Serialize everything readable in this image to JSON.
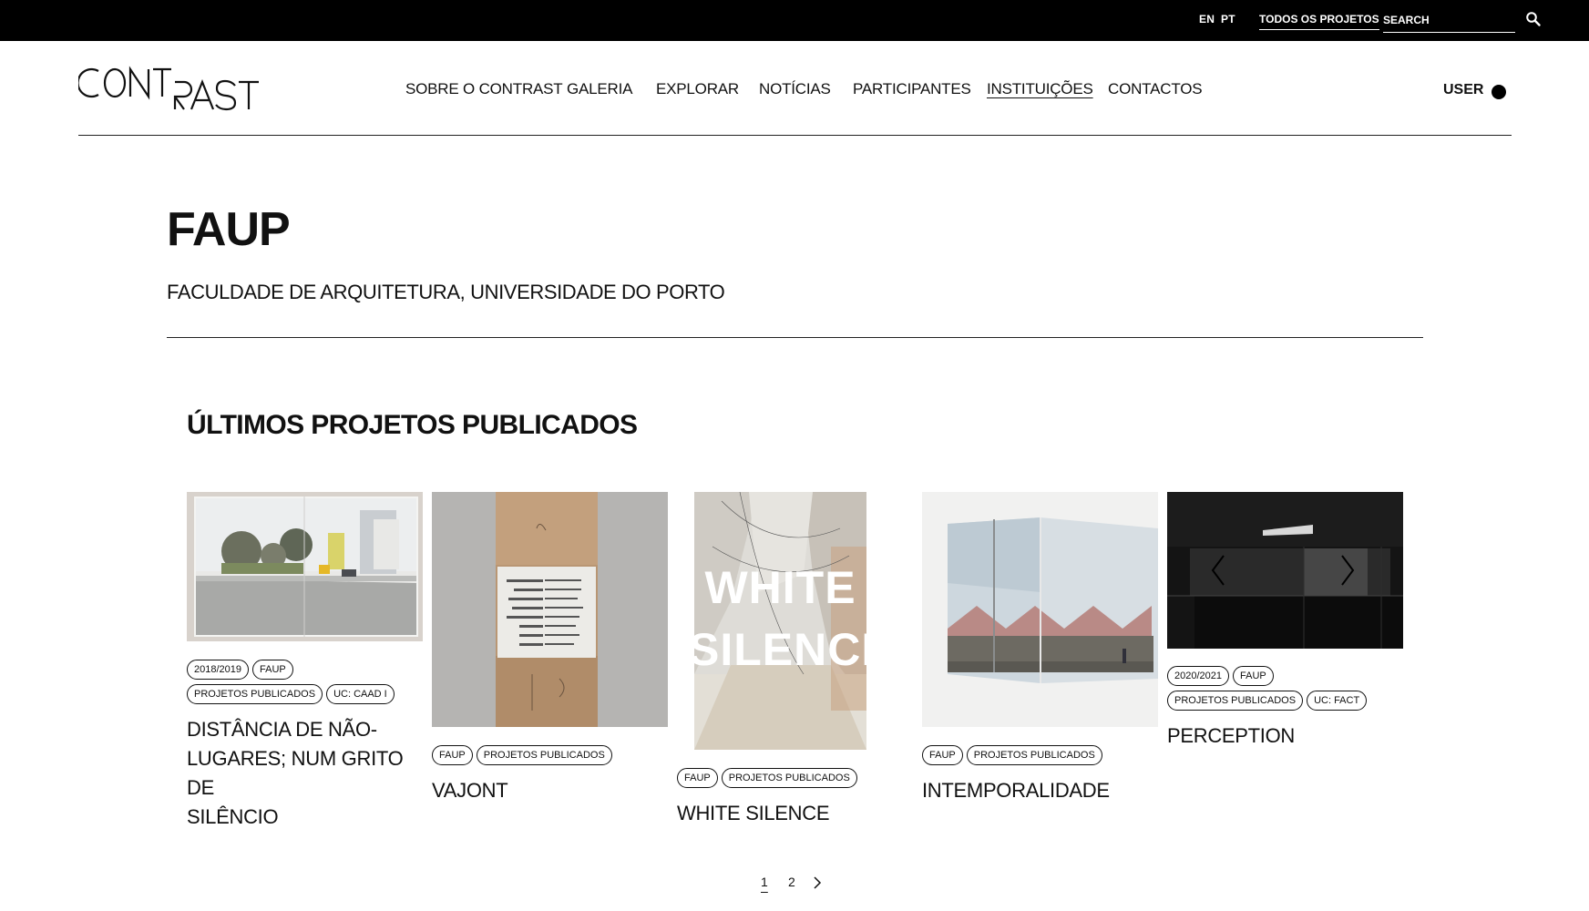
{
  "topbar": {
    "lang_en": "EN",
    "lang_pt": "PT",
    "all_projects": "TODOS OS PROJETOS",
    "search_placeholder": "SEARCH",
    "search_icon": "search-icon"
  },
  "header": {
    "logo_text": "CONTRAST",
    "nav": [
      {
        "label": "SOBRE O CONTRAST"
      },
      {
        "label": "GALERIA"
      },
      {
        "label": "EXPLORAR"
      },
      {
        "label": "NOTÍCIAS"
      },
      {
        "label": "PARTICIPANTES"
      },
      {
        "label": "INSTITUIÇÕES",
        "active": true
      },
      {
        "label": "CONTACTOS"
      }
    ],
    "user_label": "USER"
  },
  "institution": {
    "title": "FAUP",
    "subtitle": "FACULDADE DE ARQUITETURA, UNIVERSIDADE DO PORTO"
  },
  "section": {
    "title": "ÚLTIMOS PROJETOS PUBLICADOS"
  },
  "projects": [
    {
      "tags": [
        "2018/2019",
        "FAUP",
        "PROJETOS PUBLICADOS",
        "UC: CAAD I"
      ],
      "title_lines": [
        "DISTÂNCIA DE NÃO-",
        "LUGARES; NUM GRITO DE",
        "SILÊNCIO"
      ]
    },
    {
      "tags": [
        "FAUP",
        "PROJETOS PUBLICADOS"
      ],
      "title_lines": [
        "VAJONT"
      ]
    },
    {
      "tags": [
        "FAUP",
        "PROJETOS PUBLICADOS"
      ],
      "title_lines": [
        "WHITE SILENCE"
      ],
      "overlay_lines": [
        "WHITE",
        "SILENCE"
      ]
    },
    {
      "tags": [
        "FAUP",
        "PROJETOS PUBLICADOS"
      ],
      "title_lines": [
        "INTEMPORALIDADE"
      ]
    },
    {
      "tags": [
        "2020/2021",
        "FAUP",
        "PROJETOS PUBLICADOS",
        "UC: FACT"
      ],
      "title_lines": [
        "PERCEPTION"
      ]
    }
  ],
  "pagination": {
    "pages": [
      "1",
      "2"
    ],
    "current": "1"
  }
}
